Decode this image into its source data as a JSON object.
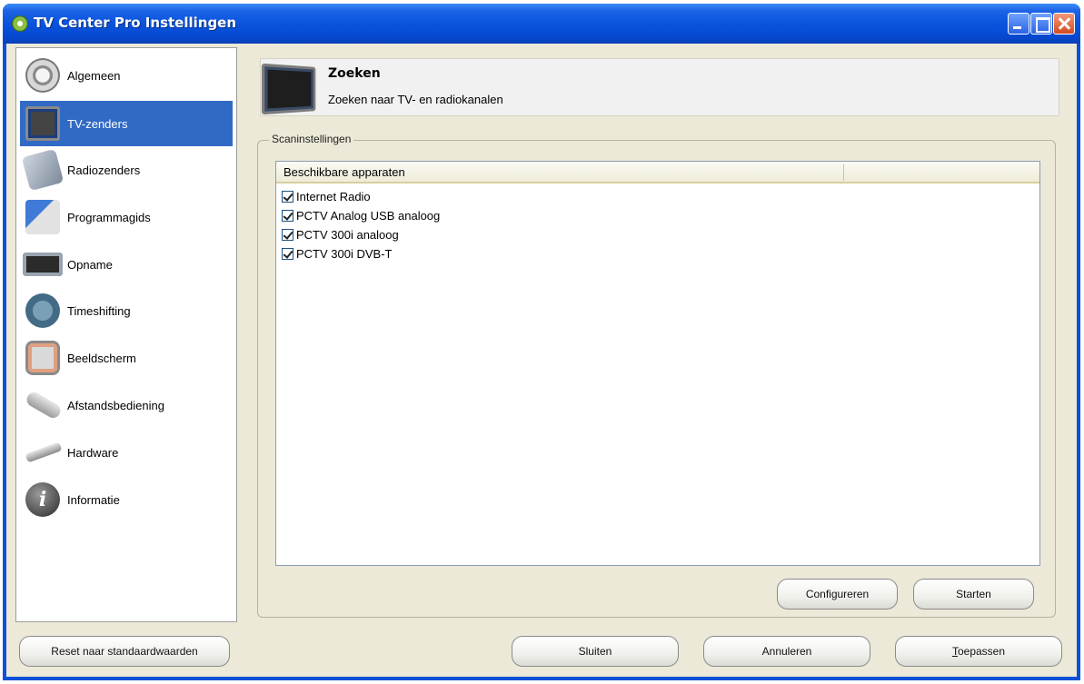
{
  "window": {
    "title": "TV Center Pro Instellingen"
  },
  "sidebar": {
    "items": [
      {
        "label": "Algemeen",
        "icon": "settings-icon"
      },
      {
        "label": "TV-zenders",
        "icon": "tv-icon",
        "selected": true
      },
      {
        "label": "Radiozenders",
        "icon": "radio-icon"
      },
      {
        "label": "Programmagids",
        "icon": "program-guide-icon"
      },
      {
        "label": "Opname",
        "icon": "recording-icon"
      },
      {
        "label": "Timeshifting",
        "icon": "timeshift-icon"
      },
      {
        "label": "Beeldscherm",
        "icon": "display-icon"
      },
      {
        "label": "Afstandsbediening",
        "icon": "remote-control-icon"
      },
      {
        "label": "Hardware",
        "icon": "hardware-icon"
      },
      {
        "label": "Informatie",
        "icon": "info-icon"
      }
    ]
  },
  "header": {
    "title": "Zoeken",
    "subtitle": "Zoeken naar TV- en radiokanalen"
  },
  "scan_group": {
    "label": "Scaninstellingen",
    "column_header": "Beschikbare apparaten",
    "devices": [
      {
        "label": "Internet Radio",
        "checked": true
      },
      {
        "label": "PCTV Analog USB analoog",
        "checked": true
      },
      {
        "label": "PCTV 300i analoog",
        "checked": true
      },
      {
        "label": "PCTV 300i DVB-T",
        "checked": true
      }
    ],
    "configure_label": "Configureren",
    "start_label": "Starten"
  },
  "footer": {
    "reset_label": "Reset naar standaardwaarden",
    "close_label": "Sluiten",
    "cancel_label": "Annuleren",
    "apply_underlined": "T",
    "apply_rest": "oepassen"
  },
  "colors": {
    "titlebar": "#0a53dd",
    "selection": "#316ac5",
    "window_bg": "#ece9d8"
  }
}
